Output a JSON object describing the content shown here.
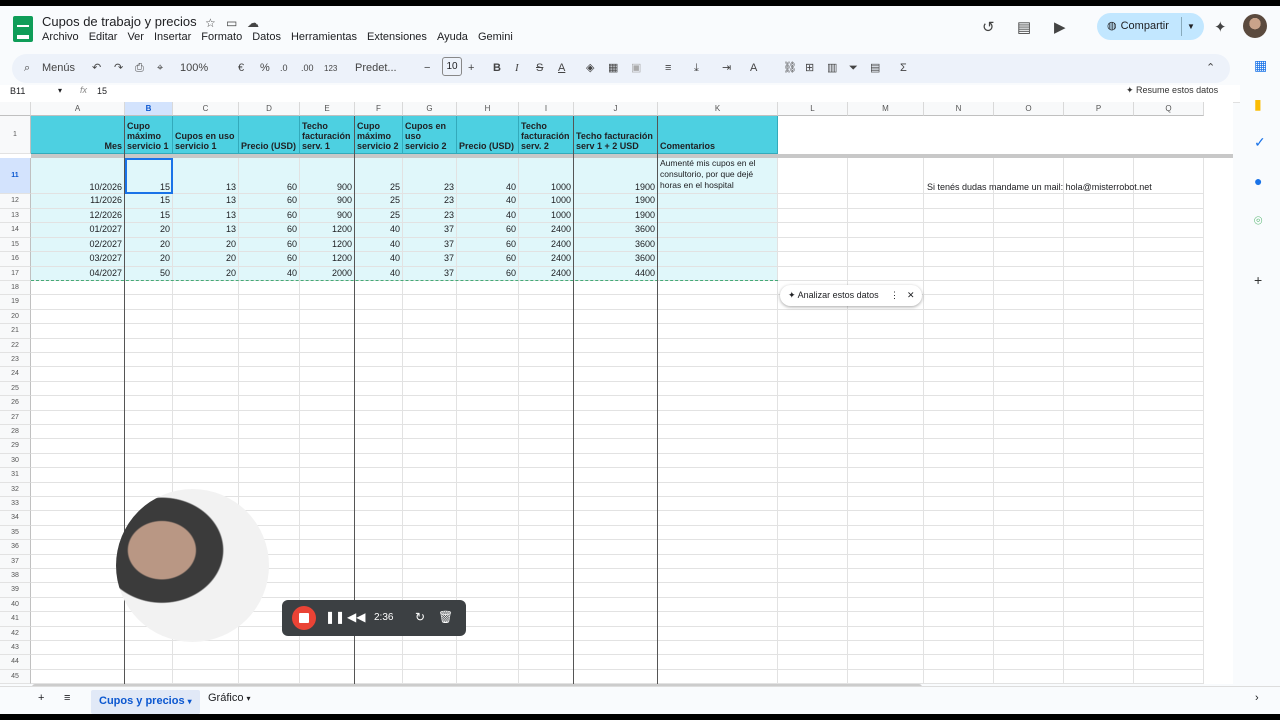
{
  "doc": {
    "title": "Cupos de trabajo y precios"
  },
  "menu": [
    "Archivo",
    "Editar",
    "Ver",
    "Insertar",
    "Formato",
    "Datos",
    "Herramientas",
    "Extensiones",
    "Ayuda",
    "Gemini"
  ],
  "share": {
    "label": "Compartir"
  },
  "toolbar": {
    "search": "Menús",
    "zoom": "100%",
    "currency": "€",
    "percent": "%",
    "dec_less": ".0",
    "dec_more": ".00",
    "numfmt": "123",
    "font": "Predet...",
    "font_size": "10"
  },
  "formula_bar": {
    "name_box": "B11",
    "fx": "fx",
    "value": "15",
    "resume": "Resume estos datos"
  },
  "columns": [
    "A",
    "B",
    "C",
    "D",
    "E",
    "F",
    "G",
    "H",
    "I",
    "J",
    "K",
    "L",
    "M",
    "N",
    "O",
    "P",
    "Q"
  ],
  "header_row": {
    "num": "1",
    "cells": [
      "Mes",
      "Cupo máximo servicio 1",
      "Cupos en uso servicio 1",
      "Precio (USD)",
      "Techo facturación serv. 1",
      "Cupo máximo servicio 2",
      "Cupos en uso servicio 2",
      "Precio (USD)",
      "Techo facturación serv. 2",
      "Techo facturación serv 1 + 2 USD",
      "Comentarios"
    ]
  },
  "rows": [
    {
      "num": "11",
      "cells": [
        "10/2026",
        "15",
        "13",
        "60",
        "900",
        "25",
        "23",
        "40",
        "1000",
        "1900"
      ],
      "comment": "Aumenté mis cupos en el consultorio, por que dejé horas en el hospital"
    },
    {
      "num": "12",
      "cells": [
        "11/2026",
        "15",
        "13",
        "60",
        "900",
        "25",
        "23",
        "40",
        "1000",
        "1900"
      ]
    },
    {
      "num": "13",
      "cells": [
        "12/2026",
        "15",
        "13",
        "60",
        "900",
        "25",
        "23",
        "40",
        "1000",
        "1900"
      ]
    },
    {
      "num": "14",
      "cells": [
        "01/2027",
        "20",
        "13",
        "60",
        "1200",
        "40",
        "37",
        "60",
        "2400",
        "3600"
      ]
    },
    {
      "num": "15",
      "cells": [
        "02/2027",
        "20",
        "20",
        "60",
        "1200",
        "40",
        "37",
        "60",
        "2400",
        "3600"
      ]
    },
    {
      "num": "16",
      "cells": [
        "03/2027",
        "20",
        "20",
        "60",
        "1200",
        "40",
        "37",
        "60",
        "2400",
        "3600"
      ]
    },
    {
      "num": "17",
      "cells": [
        "04/2027",
        "50",
        "20",
        "40",
        "2000",
        "40",
        "37",
        "60",
        "2400",
        "4400"
      ]
    }
  ],
  "empty_rows": [
    "18",
    "19",
    "20",
    "21",
    "22",
    "23",
    "24",
    "25",
    "26",
    "27",
    "28",
    "29",
    "30",
    "31",
    "32",
    "33",
    "34",
    "35",
    "36",
    "37",
    "38",
    "39",
    "40",
    "41",
    "42",
    "43",
    "44",
    "45"
  ],
  "contact_note": "Si tenés dudas mandame un mail: hola@misterrobot.net",
  "analyze": {
    "label": "Analizar estos datos"
  },
  "recorder": {
    "time": "2:36"
  },
  "sheets": {
    "active": "Cupos y precios",
    "other": "Gráfico"
  },
  "colors": {
    "header_bg": "#4dd0e1",
    "row_bg": "#e0f7fa",
    "accent": "#0b57d0"
  }
}
